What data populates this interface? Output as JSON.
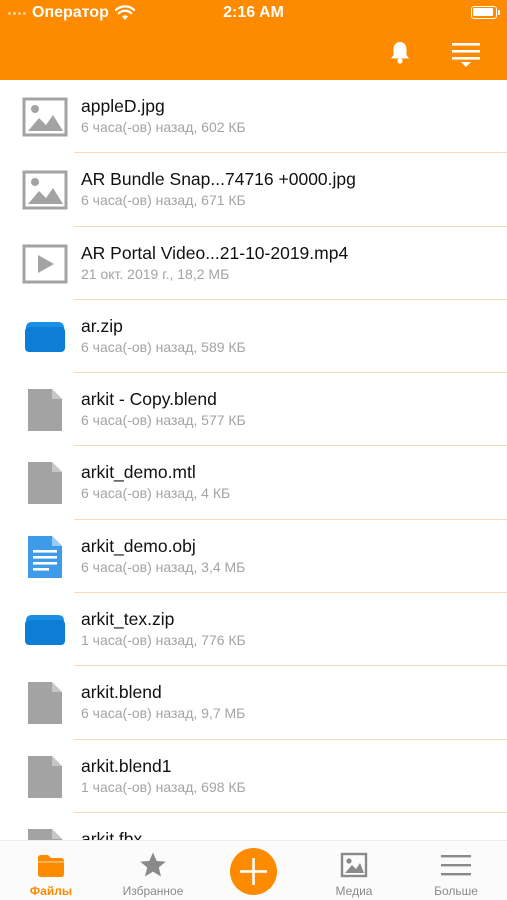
{
  "status_bar": {
    "carrier": "Оператор",
    "time": "2:16 AM"
  },
  "colors": {
    "accent": "#fe8a00",
    "meta_text": "#a4a4a4",
    "divider": "#f6d9b6",
    "doc_blue": "#3d9be9",
    "archive_blue": "#0d7ed6",
    "generic_gray": "#a3a3a3"
  },
  "header": {
    "notifications_icon": "bell-icon",
    "sort_icon": "sort-menu-icon"
  },
  "files": [
    {
      "name": "appleD.jpg",
      "meta": "6 часа(-ов) назад, 602 КБ",
      "icon": "image-file-icon"
    },
    {
      "name": "AR Bundle Snap...74716 +0000.jpg",
      "meta": "6 часа(-ов) назад, 671 КБ",
      "icon": "image-file-icon"
    },
    {
      "name": "AR Portal Video...21-10-2019.mp4",
      "meta": "21 окт. 2019 г., 18,2 МБ",
      "icon": "video-file-icon"
    },
    {
      "name": "ar.zip",
      "meta": "6 часа(-ов) назад, 589 КБ",
      "icon": "archive-file-icon"
    },
    {
      "name": "arkit - Copy.blend",
      "meta": "6 часа(-ов) назад, 577 КБ",
      "icon": "generic-file-icon"
    },
    {
      "name": "arkit_demo.mtl",
      "meta": "6 часа(-ов) назад, 4 КБ",
      "icon": "generic-file-icon"
    },
    {
      "name": "arkit_demo.obj",
      "meta": "6 часа(-ов) назад, 3,4 МБ",
      "icon": "document-file-icon"
    },
    {
      "name": "arkit_tex.zip",
      "meta": "1 часа(-ов) назад, 776 КБ",
      "icon": "archive-file-icon"
    },
    {
      "name": "arkit.blend",
      "meta": "6 часа(-ов) назад, 9,7 МБ",
      "icon": "generic-file-icon"
    },
    {
      "name": "arkit.blend1",
      "meta": "1 часа(-ов) назад, 698 КБ",
      "icon": "generic-file-icon"
    },
    {
      "name": "arkit.fbx",
      "meta": "",
      "icon": "generic-file-icon"
    }
  ],
  "tabbar": {
    "tabs": [
      {
        "label": "Файлы",
        "icon": "folder-icon",
        "active": true
      },
      {
        "label": "Избранное",
        "icon": "star-icon",
        "active": false
      },
      {
        "label": "Медиа",
        "icon": "media-icon",
        "active": false
      },
      {
        "label": "Больше",
        "icon": "more-menu-icon",
        "active": false
      }
    ],
    "add_button_icon": "plus-icon"
  }
}
